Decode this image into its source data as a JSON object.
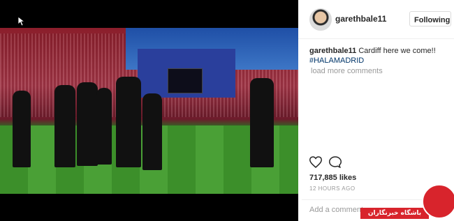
{
  "post": {
    "username": "garethbale11",
    "follow_label": "Following",
    "caption_user": "garethbale11",
    "caption_text": "Cardiff here we come!!",
    "hashtag": "#HALAMADRID",
    "load_more": "load more comments",
    "likes": "717,885 likes",
    "timestamp": "12 HOURS AGO",
    "comment_placeholder": "Add a comment..."
  },
  "icons": {
    "heart": "heart-icon",
    "comment": "comment-icon",
    "cursor": "cursor-icon"
  },
  "watermark": {
    "text": "باشگاه خبرنگاران"
  },
  "colors": {
    "hashtag": "#003569",
    "watermark": "#d8242c"
  }
}
